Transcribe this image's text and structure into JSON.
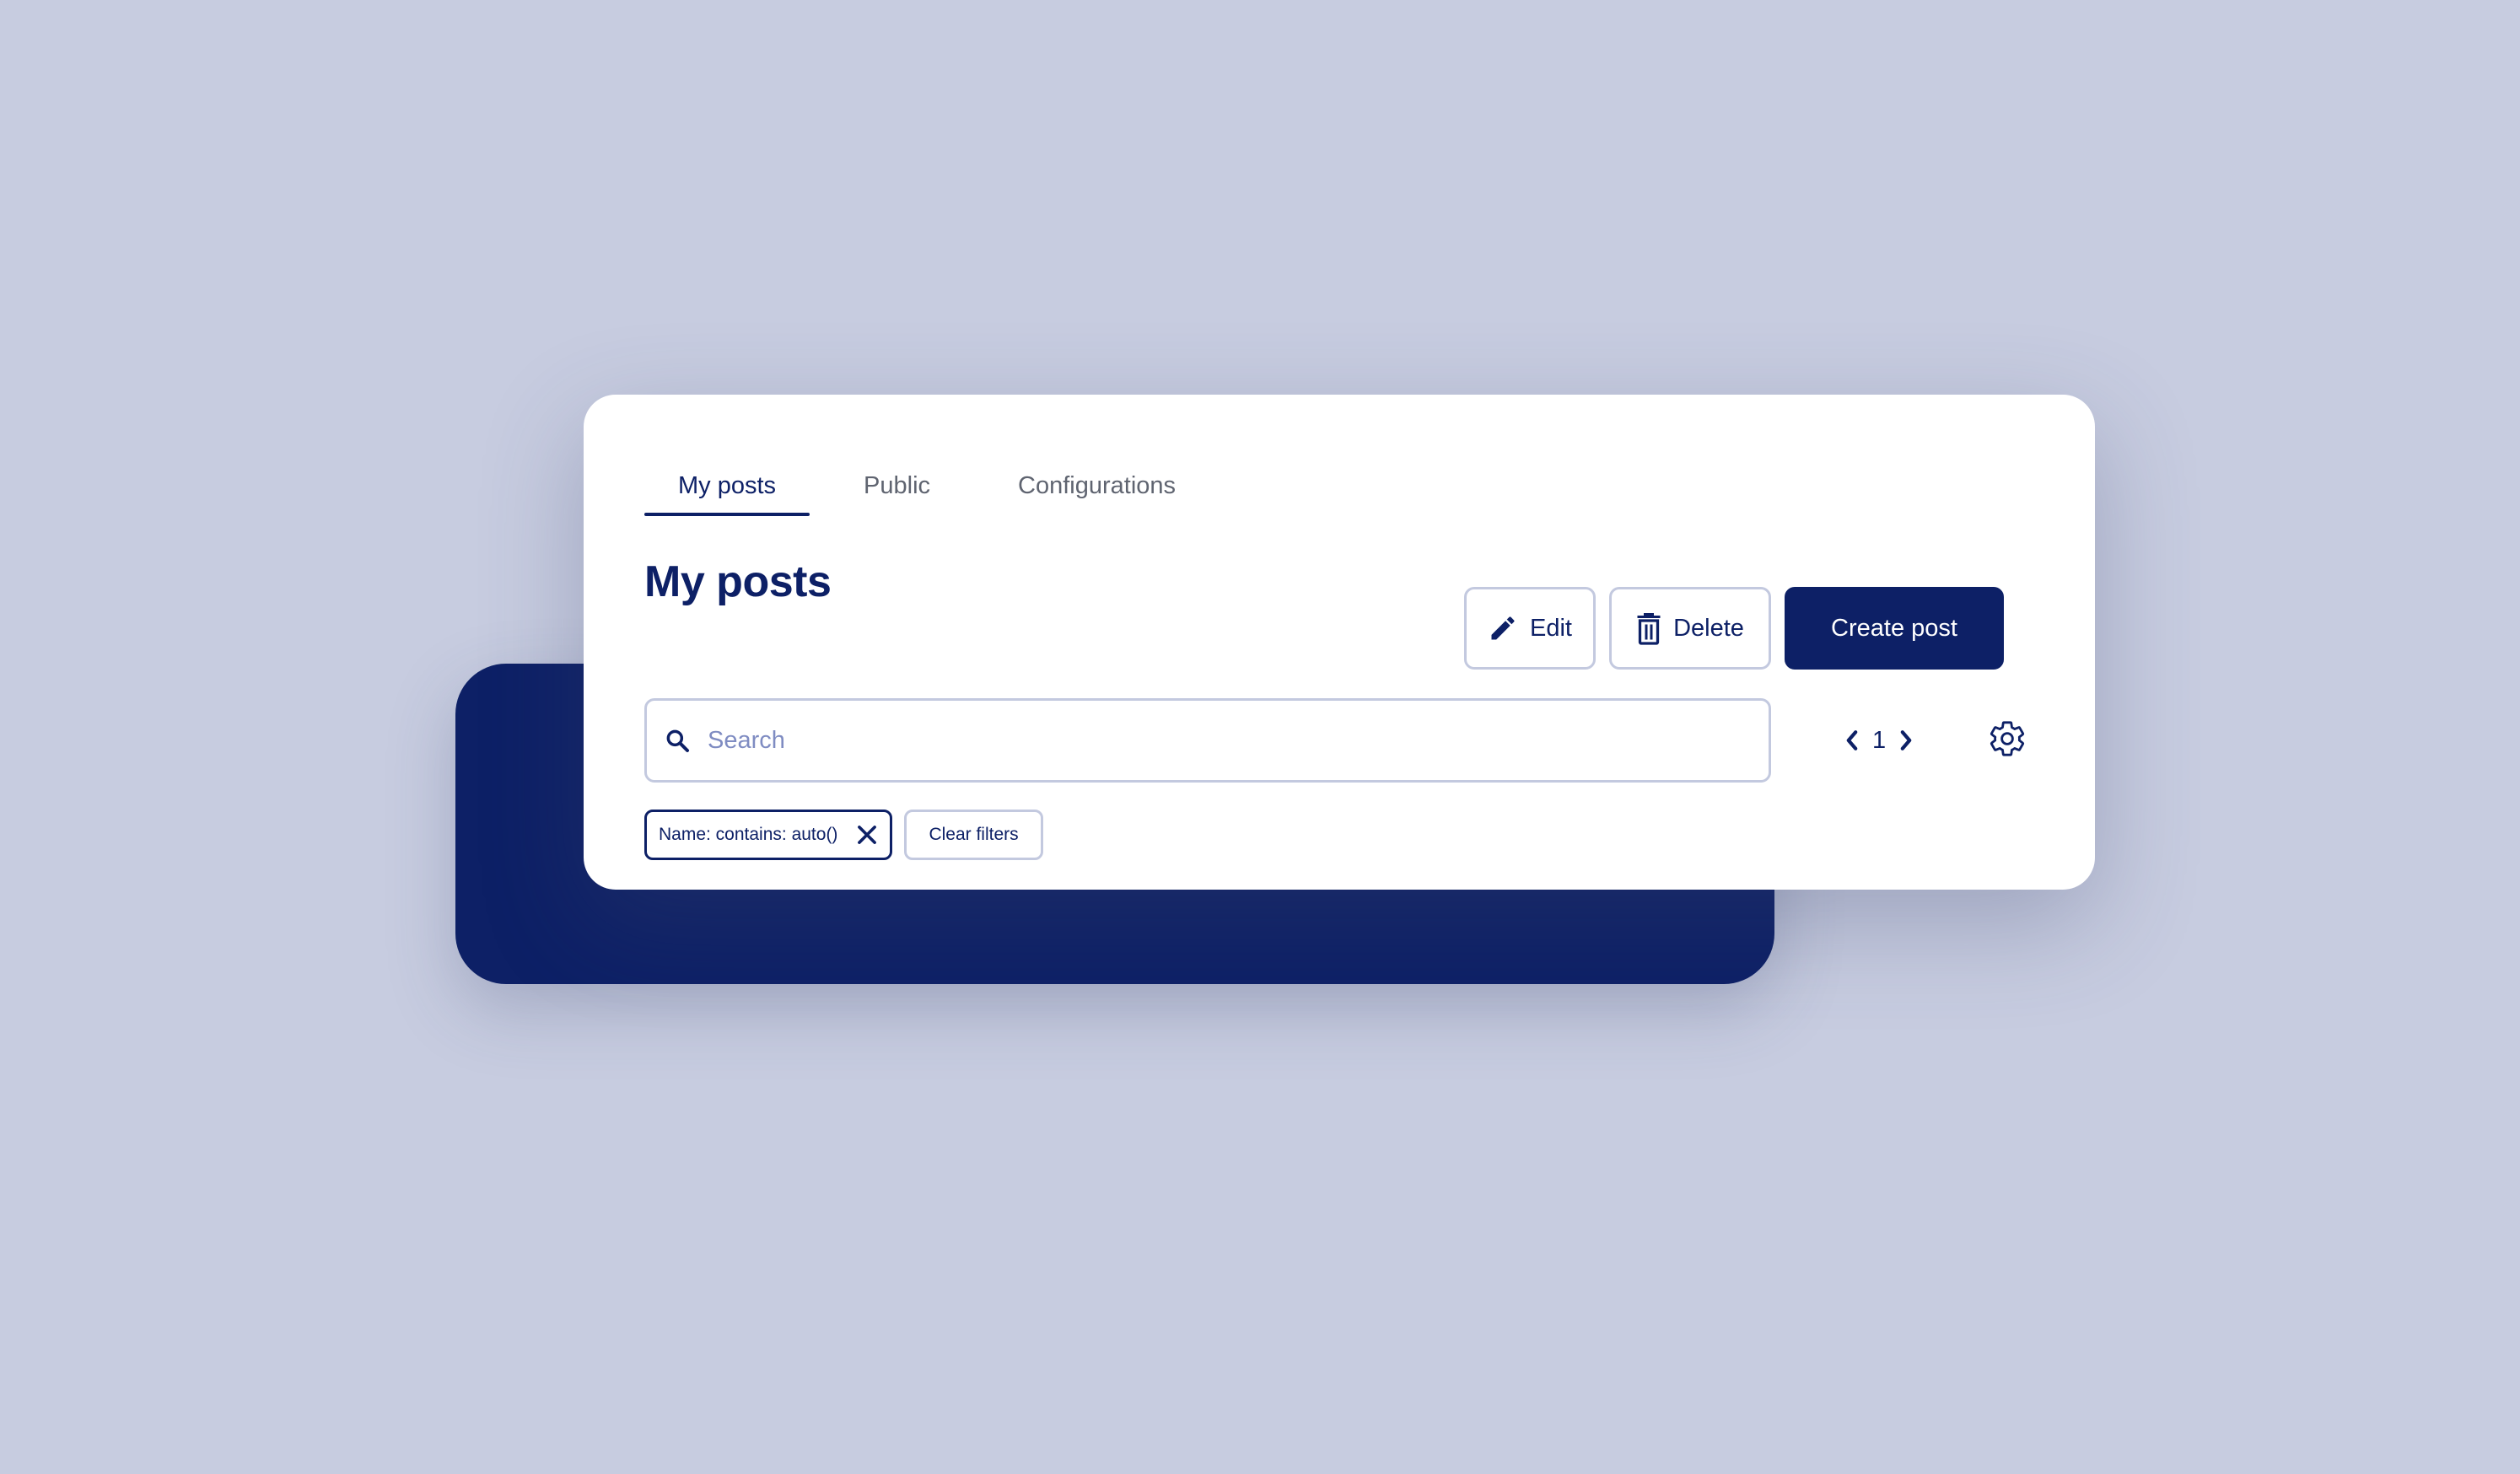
{
  "colors": {
    "background": "#c7cce0",
    "navy": "#0d2066",
    "card": "#ffffff",
    "border": "#c3c9df",
    "placeholder": "#7f8cc2",
    "tab_inactive": "#5f6470"
  },
  "tabs": [
    {
      "label": "My posts",
      "active": true
    },
    {
      "label": "Public",
      "active": false
    },
    {
      "label": "Configurations",
      "active": false
    }
  ],
  "page": {
    "title": "My posts"
  },
  "toolbar": {
    "edit_label": "Edit",
    "edit_icon": "pencil-icon",
    "delete_label": "Delete",
    "delete_icon": "trash-icon",
    "create_label": "Create post"
  },
  "search": {
    "placeholder": "Search",
    "value": "",
    "icon": "search-icon"
  },
  "pagination": {
    "current_page": "1",
    "prev_icon": "chevron-left-icon",
    "next_icon": "chevron-right-icon"
  },
  "settings": {
    "icon": "gear-icon"
  },
  "filters": {
    "active": [
      {
        "label": "Name: contains: auto()",
        "remove_icon": "close-icon"
      }
    ],
    "clear_label": "Clear filters"
  }
}
